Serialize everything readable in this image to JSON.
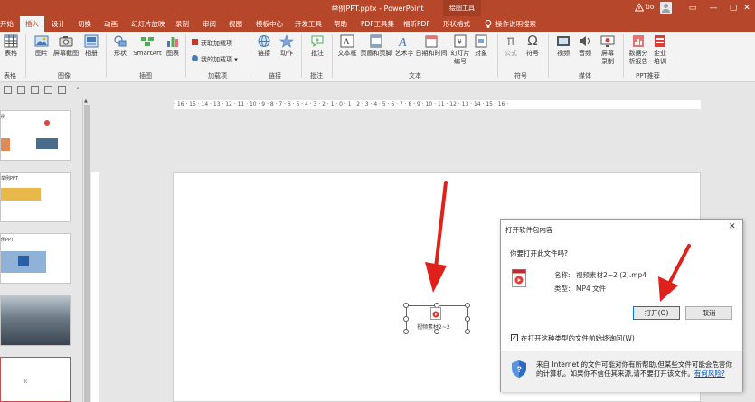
{
  "titlebar": {
    "doc_title": "举例PPT.pptx  -  PowerPoint",
    "tools_tab": "绘图工具",
    "user": "bo",
    "win_buttons": [
      "—",
      "▢",
      "✕"
    ]
  },
  "tabs": [
    {
      "label": "开始"
    },
    {
      "label": "插入",
      "active": true
    },
    {
      "label": "设计"
    },
    {
      "label": "切换"
    },
    {
      "label": "动画"
    },
    {
      "label": "幻灯片放映"
    },
    {
      "label": "录制"
    },
    {
      "label": "审阅"
    },
    {
      "label": "视图"
    },
    {
      "label": "模板中心"
    },
    {
      "label": "开发工具"
    },
    {
      "label": "帮助"
    },
    {
      "label": "PDF工具集"
    },
    {
      "label": "福昕PDF"
    },
    {
      "label": "形状格式"
    },
    {
      "label": "操作说明搜索"
    }
  ],
  "ribbon": {
    "table": "表格",
    "picture": "图片",
    "screenshot": "屏幕截图",
    "album": "相册",
    "shape": "形状",
    "smartart": "SmartArt",
    "chart": "图表",
    "get_addins": "获取加载项",
    "my_addins": "我的加载项",
    "link": "链接",
    "action": "动作",
    "comment": "批注",
    "textbox": "文本框",
    "header_footer": "页眉和页脚",
    "wordart": "艺术字",
    "datetime": "日期和时间",
    "slide_number": "幻灯片编号",
    "object": "对象",
    "equation": "公式",
    "symbol": "符号",
    "video": "视频",
    "audio": "音频",
    "screen_record": "屏幕录制",
    "data_report": "数据分析报告",
    "enterprise_training": "企业培训",
    "groups": {
      "tables": "表格",
      "images": "图像",
      "illustrations": "插图",
      "addins": "加载项",
      "links": "链接",
      "comments": "批注",
      "text": "文本",
      "symbols": "符号",
      "media": "媒体",
      "ppt_recommend": "PPT推荐"
    }
  },
  "thumbnails": [
    {
      "caption": "例"
    },
    {
      "caption": "举例PPT"
    },
    {
      "caption": "例PPT"
    },
    {
      "caption": ""
    },
    {
      "caption": "K"
    }
  ],
  "ruler": {
    "marks": "· 16 · 15 · 14 · 13 · 12 · 11 · 10 · 9 · 8 · 7 · 6 · 5 · 4 · 3 · 2 · 1 · 0 · 1 · 2 · 3 · 4 · 5 · 6 · 7 · 8 · 9 · 10 · 11 · 12 · 13 · 14 · 15 · 16 ·"
  },
  "media": {
    "label": "视频素材2~2"
  },
  "dialog": {
    "title": "打开软件包内容",
    "close": "✕",
    "question": "你要打开此文件吗?",
    "name_label": "名称:",
    "name_value": "视频素材2~2 (2).mp4",
    "type_label": "类型:",
    "type_value": "MP4 文件",
    "open_button": "打开(O)",
    "cancel_button": "取消",
    "always_ask": "在打开这种类型的文件前始终询问(W)",
    "always_ask_checked": true,
    "warning": "来自 Internet 的文件可能对你有所帮助,但某些文件可能会危害你的计算机。如果你不信任其来源,请不要打开该文件。",
    "risk_link": "有何风险?"
  },
  "colors": {
    "brand": "#b7472a",
    "arrow": "#e0201b",
    "accent_blue": "#0078d7"
  }
}
